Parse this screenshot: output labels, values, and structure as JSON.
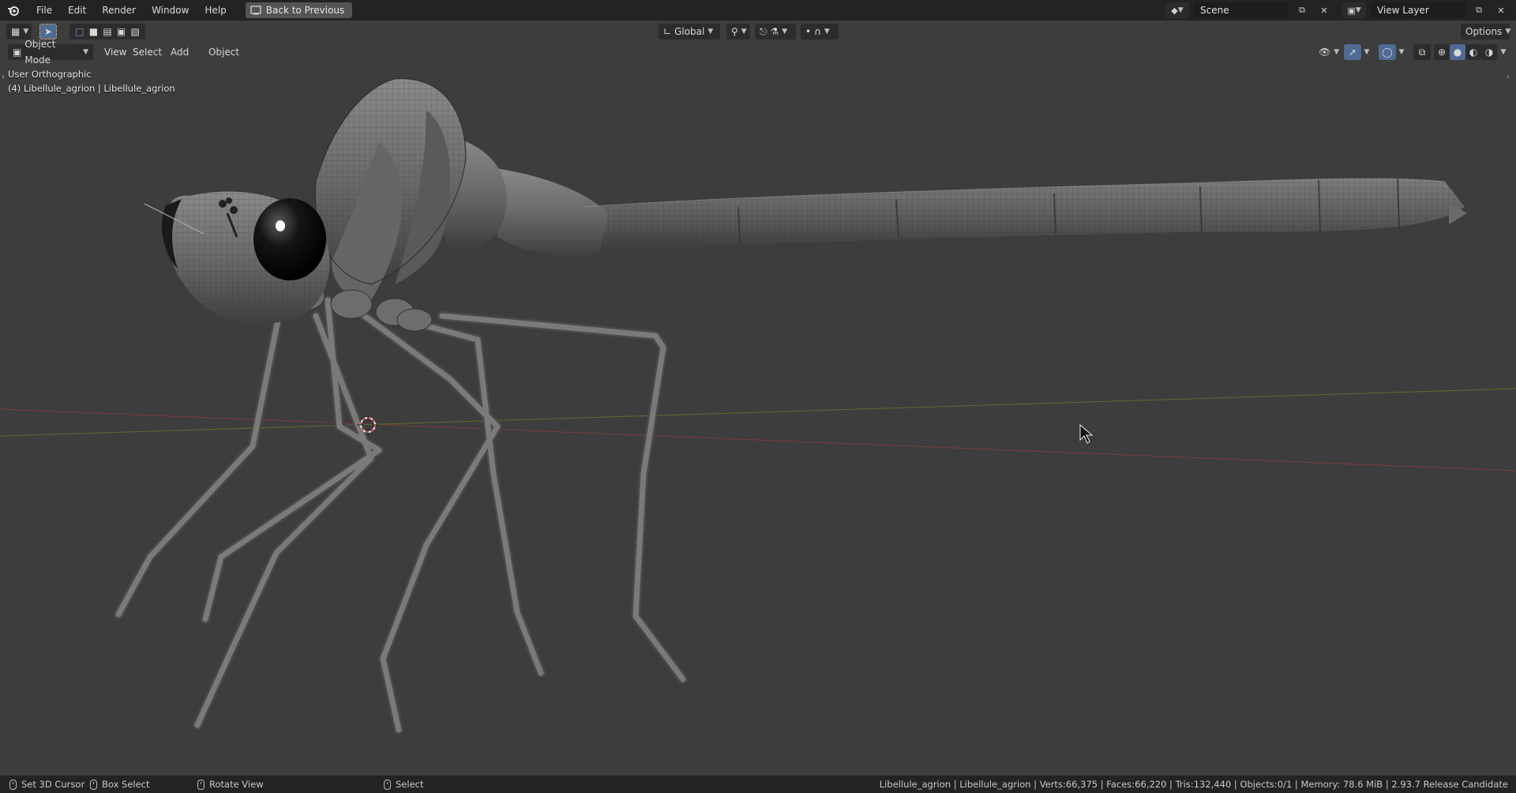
{
  "menu": {
    "items": [
      "File",
      "Edit",
      "Render",
      "Window",
      "Help"
    ],
    "back_button": "Back to Previous"
  },
  "top_right": {
    "scene_value": "Scene",
    "view_layer_value": "View Layer"
  },
  "tool_header": {
    "transform_orientation": "Global",
    "options_label": "Options"
  },
  "view_header": {
    "mode": "Object Mode",
    "menus": [
      "View",
      "Select",
      "Add",
      "Object"
    ]
  },
  "viewport": {
    "view_name": "User Orthographic",
    "object_info": "(4) Libellule_agrion | Libellule_agrion"
  },
  "status_bar": {
    "set_cursor": "Set 3D Cursor",
    "box_select": "Box Select",
    "rotate_view": "Rotate View",
    "select": "Select",
    "stats": "Libellule_agrion | Libellule_agrion | Verts:66,375 | Faces:66,220 | Tris:132,440 | Objects:0/1 | Memory: 78.6 MiB | 2.93.7 Release Candidate"
  },
  "icons": [
    "blender-logo-icon",
    "editor-type-icon",
    "select-arrow-icon",
    "box-select-mode-icon",
    "transform-orientation-icon",
    "pivot-icon",
    "snap-icon",
    "proportional-icon",
    "scene-icon",
    "view-layer-icon",
    "visibility-icon",
    "gizmo-icon",
    "overlay-icon",
    "xray-icon",
    "shading-wireframe-icon",
    "shading-solid-icon",
    "shading-material-icon",
    "shading-rendered-icon",
    "mouse-cursor-icon",
    "3d-cursor-icon"
  ],
  "colors": {
    "viewport_bg": "#3d3d3d",
    "topbar_bg": "#232323",
    "active_blue": "#4f6b93",
    "x_axis": "#8a3a3a",
    "y_axis": "#5d7a2d"
  }
}
